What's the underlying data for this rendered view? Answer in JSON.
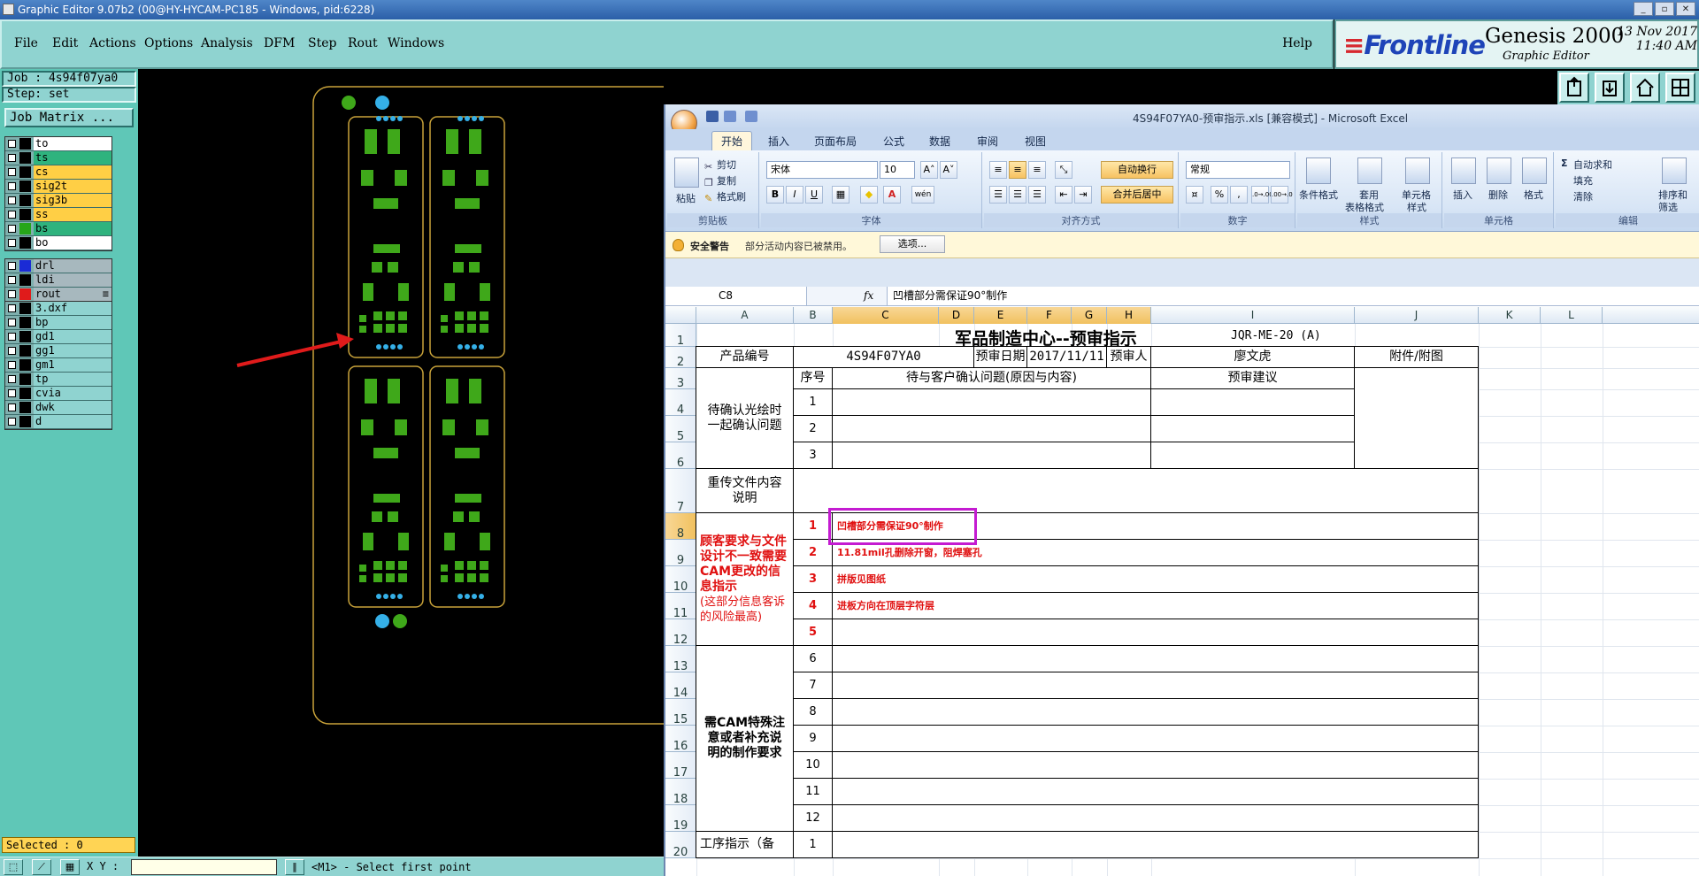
{
  "window": {
    "title": "Graphic Editor 9.07b2 (00@HY-HYCAM-PC185 - Windows, pid:6228)",
    "btn_min": "_",
    "btn_max": "▫",
    "btn_close": "✕"
  },
  "menu": {
    "items": [
      "File",
      "Edit",
      "Actions",
      "Options",
      "Analysis",
      "DFM",
      "Step",
      "Rout",
      "Windows"
    ],
    "help": "Help"
  },
  "brand": {
    "logo_a": "≡",
    "logo_b": "Frontline",
    "product": "Genesis 2000",
    "subtitle": "Graphic Editor",
    "date": "13 Nov 2017",
    "time": "11:40 AM"
  },
  "left": {
    "job": "Job : 4s94f07ya0",
    "step": "Step: set",
    "job_matrix": "Job Matrix ...",
    "layer_groups": [
      [
        {
          "name": "to",
          "color": "#ffffff",
          "swatch": "#000000"
        },
        {
          "name": "ts",
          "color": "#2fb37e",
          "swatch": "#000000"
        },
        {
          "name": "cs",
          "color": "#ffcf45",
          "swatch": "#000000"
        },
        {
          "name": "sig2t",
          "color": "#ffcf45",
          "swatch": "#000000"
        },
        {
          "name": "sig3b",
          "color": "#ffcf45",
          "swatch": "#000000"
        },
        {
          "name": "ss",
          "color": "#ffcf45",
          "swatch": "#000000"
        },
        {
          "name": "bs",
          "color": "#2fb37e",
          "swatch": "#26a61a"
        },
        {
          "name": "bo",
          "color": "#ffffff",
          "swatch": "#000000"
        }
      ],
      [
        {
          "name": "drl",
          "color": "#a7b8be",
          "swatch": "#1a2bd6"
        },
        {
          "name": "ldi",
          "color": "#a7b8be",
          "swatch": "#000000"
        },
        {
          "name": "rout",
          "color": "#a7b8be",
          "swatch": "#e01b1b",
          "mark": "≡"
        }
      ],
      [
        {
          "name": "3.dxf",
          "color": "#8fd3d0",
          "swatch": "#000000"
        },
        {
          "name": "bp",
          "color": "#8fd3d0",
          "swatch": "#000000"
        },
        {
          "name": "gd1",
          "color": "#8fd3d0",
          "swatch": "#000000"
        },
        {
          "name": "gg1",
          "color": "#8fd3d0",
          "swatch": "#000000"
        },
        {
          "name": "gm1",
          "color": "#8fd3d0",
          "swatch": "#000000"
        },
        {
          "name": "tp",
          "color": "#8fd3d0",
          "swatch": "#000000"
        },
        {
          "name": "cvia",
          "color": "#8fd3d0",
          "swatch": "#000000"
        },
        {
          "name": "dwk",
          "color": "#8fd3d0",
          "swatch": "#000000"
        },
        {
          "name": "d",
          "color": "#8fd3d0",
          "swatch": "#000000"
        }
      ]
    ],
    "selected": "Selected : 0"
  },
  "status": {
    "xy_label": "X Y :",
    "message": "<M1> - Select first point"
  },
  "toolbox_icons": [
    "import-icon",
    "export-icon",
    "home-icon",
    "panel-icon"
  ],
  "excel": {
    "title": "4S94F07YA0-预审指示.xls  [兼容模式] - Microsoft Excel",
    "tabs": [
      "开始",
      "插入",
      "页面布局",
      "公式",
      "数据",
      "审阅",
      "视图"
    ],
    "ribbon": {
      "clipboard": {
        "label": "剪贴板",
        "paste": "粘贴",
        "cut": "剪切",
        "copy": "复制",
        "format_painter": "格式刷"
      },
      "font": {
        "label": "字体",
        "name": "宋体",
        "size": "10",
        "bold": "B",
        "italic": "I",
        "underline": "U",
        "grow": "A˄",
        "shrink": "A˅",
        "color": "A",
        "wen": "wén"
      },
      "align": {
        "label": "对齐方式",
        "wrap": "自动换行",
        "merge": "合并后居中"
      },
      "number": {
        "label": "数字",
        "format": "常规",
        "percent": "%",
        "comma": ",",
        "inc": ".0→.00",
        "dec": ".00→.0"
      },
      "styles": {
        "label": "样式",
        "cond": "条件格式",
        "table1": "套用",
        "table2": "表格格式",
        "cell1": "单元格",
        "cell2": "样式"
      },
      "cells": {
        "label": "单元格",
        "insert": "插入",
        "delete": "删除",
        "format": "格式"
      },
      "edit": {
        "label": "编辑",
        "autosum": "自动求和",
        "fill": "填充",
        "clear": "清除",
        "sort1": "排序和",
        "sort2": "筛选"
      }
    },
    "security": {
      "head": "安全警告",
      "msg": "部分活动内容已被禁用。",
      "btn": "选项..."
    },
    "namebox": "C8",
    "fx": "fx",
    "formula": "凹槽部分需保证90°制作",
    "columns": [
      "A",
      "B",
      "C",
      "D",
      "E",
      "F",
      "G",
      "H",
      "I",
      "J",
      "K",
      "L"
    ],
    "rows": [
      "1",
      "2",
      "3",
      "4",
      "5",
      "6",
      "7",
      "8",
      "9",
      "10",
      "11",
      "12",
      "13",
      "14",
      "15",
      "16",
      "17",
      "18",
      "19",
      "20"
    ],
    "sheet": {
      "title": "军品制造中心--预审指示",
      "code": "JQR-ME-20 (A)",
      "r2": {
        "prod_label": "产品编号",
        "prod": "4S94F07YA0",
        "date_label": "预审日期",
        "date": "2017/11/11",
        "rev_label": "预审人",
        "reviewer": "廖文虎",
        "attach": "附件/附图"
      },
      "r3": {
        "seq": "序号",
        "issue": "待与客户确认问题(原因与内容)",
        "advice": "预审建议"
      },
      "confirm_label": "待确认光绘时一起确认问题",
      "confirm_nums": [
        "1",
        "2",
        "3"
      ],
      "reupload_label": "重传文件内容说明",
      "cust_label": "顾客要求与文件设计不一致需要CAM更改的信息指示",
      "cust_note": "(这部分信息客诉的风险最高)",
      "cust_nums": [
        "1",
        "2",
        "3",
        "4",
        "5"
      ],
      "cust_items": [
        "凹槽部分需保证90°制作",
        "11.81mil孔删除开窗，阻焊塞孔",
        "拼版见图纸",
        "进板方向在顶层字符层",
        ""
      ],
      "cam_label": "需CAM特殊注意或者补充说明的制作要求",
      "cam_nums": [
        "6",
        "7",
        "8",
        "9",
        "10",
        "11",
        "12"
      ],
      "proc_label": "工序指示（备",
      "proc_nums": [
        "1"
      ]
    }
  }
}
